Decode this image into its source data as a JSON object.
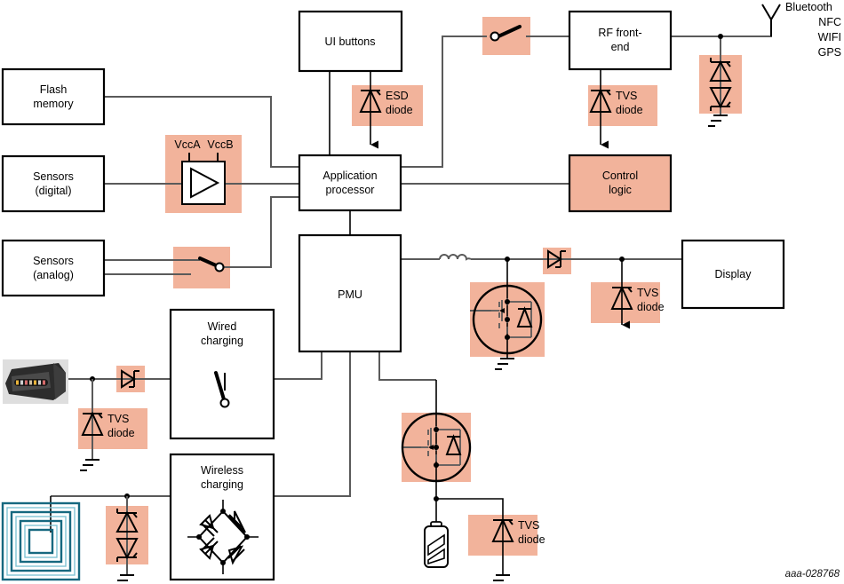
{
  "figure": {
    "id_label": "aaa-028768",
    "accent_highlight": "#f2b39b",
    "wire_color": "#5a5a5a",
    "coil_color": "#16687f"
  },
  "blocks": {
    "flash_memory": "Flash\nmemory",
    "flash_memory_l1": "Flash",
    "flash_memory_l2": "memory",
    "sensors_digital_l1": "Sensors",
    "sensors_digital_l2": "(digital)",
    "sensors_analog_l1": "Sensors",
    "sensors_analog_l2": "(analog)",
    "ui_buttons": "UI buttons",
    "application_processor_l1": "Application",
    "application_processor_l2": "processor",
    "pmu": "PMU",
    "rf_front_end_l1": "RF front-",
    "rf_front_end_l2": "end",
    "control_logic_l1": "Control",
    "control_logic_l2": "logic",
    "display": "Display",
    "wired_charging_l1": "Wired",
    "wired_charging_l2": "charging",
    "wireless_charging_l1": "Wireless",
    "wireless_charging_l2": "charging"
  },
  "components": {
    "esd_diode_l1": "ESD",
    "esd_diode_l2": "diode",
    "tvs_diode_l1": "TVS",
    "tvs_diode_l2": "diode",
    "vcca": "VccA",
    "vccb": "VccB"
  },
  "antenna": {
    "protocols": [
      "Bluetooth",
      "NFC",
      "WIFI",
      "GPS"
    ]
  }
}
